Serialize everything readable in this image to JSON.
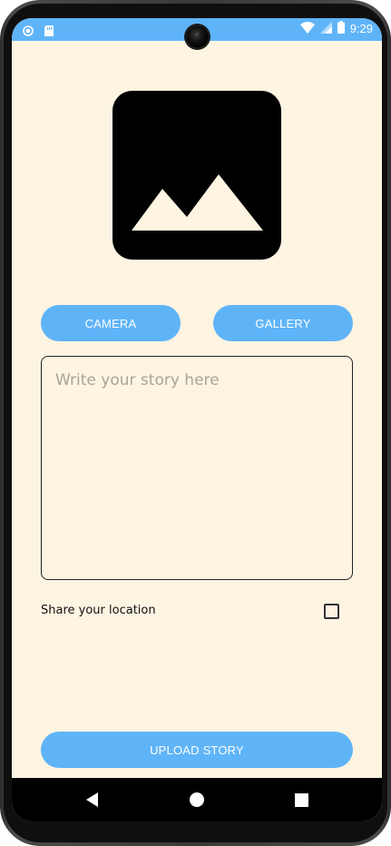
{
  "status_bar": {
    "time": "9:29",
    "icons": [
      "notification-dot-icon",
      "sim-card-icon",
      "wifi-icon",
      "signal-icon",
      "battery-icon"
    ],
    "color": "#5fb4f8"
  },
  "image_preview": {
    "icon": "image-placeholder-icon"
  },
  "buttons": {
    "camera": "CAMERA",
    "gallery": "GALLERY",
    "upload": "UPLOAD STORY",
    "color": "#5fb4f8"
  },
  "story": {
    "placeholder": "Write your story here",
    "value": ""
  },
  "location": {
    "label": "Share your location",
    "checked": false
  },
  "nav_bar": {
    "icons": [
      "back-icon",
      "home-icon",
      "recents-icon"
    ]
  },
  "theme": {
    "background": "#fef4e2"
  }
}
